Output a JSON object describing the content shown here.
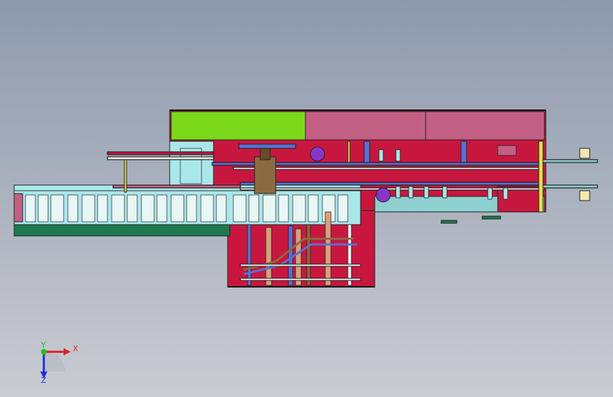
{
  "viewport": {
    "background_top": "#8d99ab",
    "background_bottom": "#c9ccd3"
  },
  "triad": {
    "x_label": "X",
    "y_label": "Y",
    "z_label": "Z",
    "x_color": "#e02020",
    "y_color": "#20c020",
    "z_color": "#2030d0"
  },
  "colors": {
    "frame_red": "#c8173f",
    "panel_green": "#7bd81a",
    "panel_pink": "#c45f84",
    "conveyor_cyan": "#a9e8ea",
    "base_green": "#1e7a4c",
    "tray_teal": "#8ecfcf",
    "rail_blue": "#5a6fd0",
    "accent_purple": "#8a35c9",
    "accent_yellow": "#e5e34a",
    "outline": "#222222"
  }
}
